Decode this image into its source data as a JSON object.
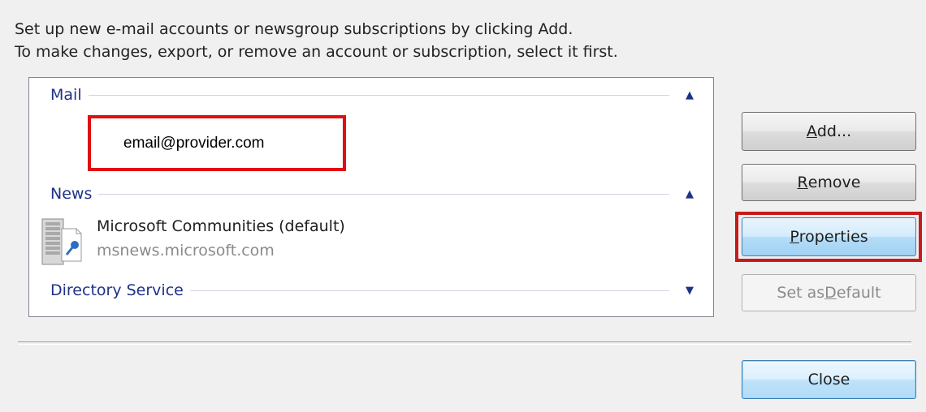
{
  "instructions": {
    "line1": "Set up new e-mail accounts or newsgroup subscriptions by clicking Add.",
    "line2": "To make changes, export, or remove an account or subscription, select it first."
  },
  "groups": {
    "mail": {
      "title": "Mail",
      "chevron": "▲"
    },
    "news": {
      "title": "News",
      "chevron": "▲"
    },
    "directory": {
      "title": "Directory Service",
      "chevron": "▼"
    }
  },
  "mail_account": {
    "address": "email@provider.com"
  },
  "news_account": {
    "name": "Microsoft Communities (default)",
    "server": "msnews.microsoft.com",
    "icon": "news-server-icon"
  },
  "buttons": {
    "add": {
      "prefix": "",
      "accel": "A",
      "suffix": "dd..."
    },
    "remove": {
      "prefix": "",
      "accel": "R",
      "suffix": "emove"
    },
    "properties": {
      "prefix": "",
      "accel": "P",
      "suffix": "roperties"
    },
    "set_default": {
      "prefix": "Set as ",
      "accel": "D",
      "suffix": "efault"
    },
    "close": "Close"
  },
  "colors": {
    "highlight_box": "#e01010",
    "group_title": "#1e3287"
  }
}
